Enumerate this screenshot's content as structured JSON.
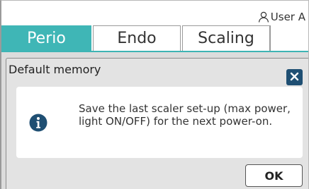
{
  "header": {
    "user_label": "User A",
    "user_icon": "person-icon"
  },
  "tabs": [
    {
      "label": "Perio",
      "active": true
    },
    {
      "label": "Endo",
      "active": false
    },
    {
      "label": "Scaling",
      "active": false
    }
  ],
  "dialog": {
    "title": "Default memory",
    "message": "Save the last scaler set-up (max power, light ON/OFF) for the next power-on.",
    "info_icon": "info-icon",
    "close_icon": "close-icon",
    "ok_label": "OK"
  },
  "colors": {
    "accent": "#3fb6b6",
    "close_button": "#1f4f73",
    "dialog_bg": "#e3e3e3"
  }
}
